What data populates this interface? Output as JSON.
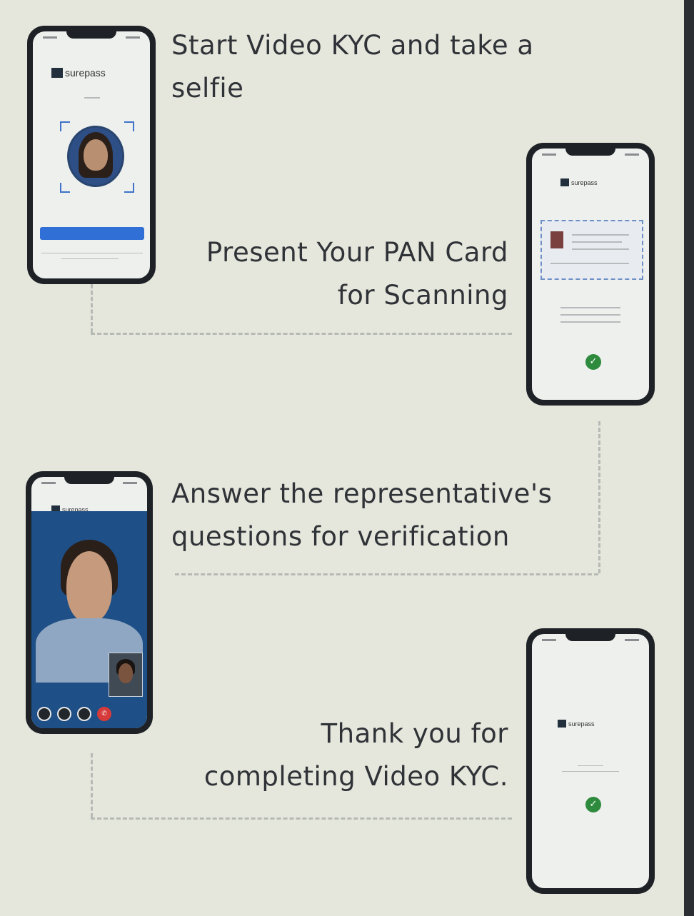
{
  "steps": [
    {
      "text_lines": [
        "Start Video KYC and take a",
        "selfie"
      ]
    },
    {
      "text_lines": [
        "Present Your PAN Card",
        "for Scanning"
      ]
    },
    {
      "text_lines": [
        "Answer the representative's",
        "questions for verification"
      ]
    },
    {
      "text_lines": [
        "Thank you for",
        "completing Video KYC."
      ]
    }
  ],
  "brand": {
    "name": "surepass"
  },
  "colors": {
    "background": "#e6e7dc",
    "text": "#2f3338",
    "phone_frame": "#1e2226",
    "accent_blue": "#2f6fd6",
    "success_green": "#2e8b3d",
    "end_call_red": "#d63a3a"
  },
  "icons": {
    "check": "✓",
    "end_call": "phone-hangup-icon"
  }
}
